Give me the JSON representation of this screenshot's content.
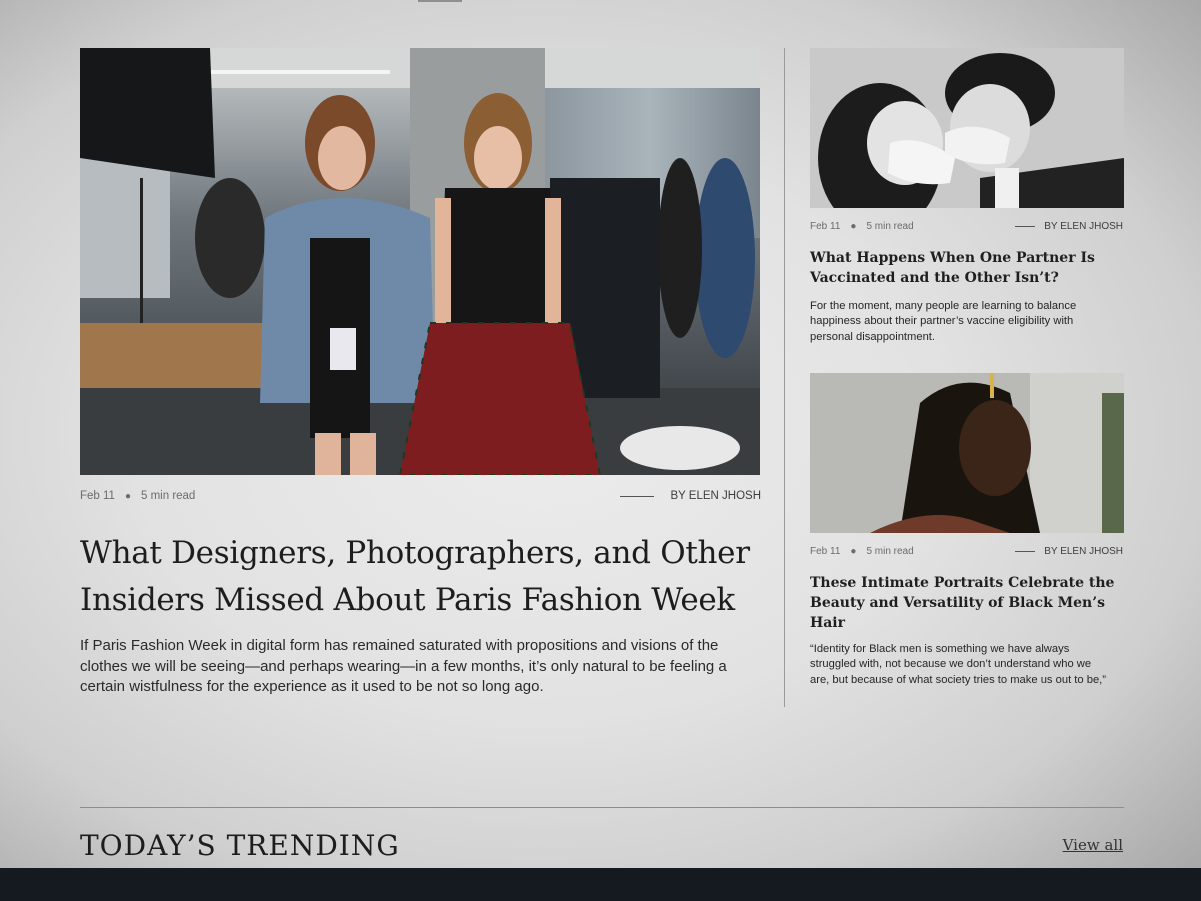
{
  "featured": {
    "date": "Feb 11",
    "read_time": "5 min read",
    "author": "BY ELEN JHOSH",
    "title": "What Designers, Photographers, and Other Insiders Missed About Paris Fashion Week",
    "excerpt": "If Paris Fashion Week in digital form has remained saturated with propositions and visions of the clothes we will be seeing—and perhaps wearing—in a few months, it’s only natural to be feeling a certain wistfulness for the experience as it used to be not so long ago."
  },
  "side_articles": [
    {
      "date": "Feb 11",
      "read_time": "5 min read",
      "author": "BY ELEN JHOSH",
      "title": "What Happens When One Partner Is Vaccinated and the Other Isn’t?",
      "excerpt": "For the moment, many people are learning to balance happiness about their partner’s vaccine eligibility with personal disappointment."
    },
    {
      "date": "Feb 11",
      "read_time": "5 min read",
      "author": "BY ELEN JHOSH",
      "title": "These Intimate Portraits Celebrate the Beauty and Versatility of Black Men’s Hair",
      "excerpt": "“Identity for Black men is something we have always struggled with, not because we don’t understand who we are, but because of what society tries to make us out to be,”"
    }
  ],
  "trending": {
    "title": "TODAY’S TRENDING",
    "view_all": "View all"
  },
  "colors": {
    "text": "#1d1d1d",
    "muted": "#6b6b6b",
    "footer": "#141a20"
  }
}
